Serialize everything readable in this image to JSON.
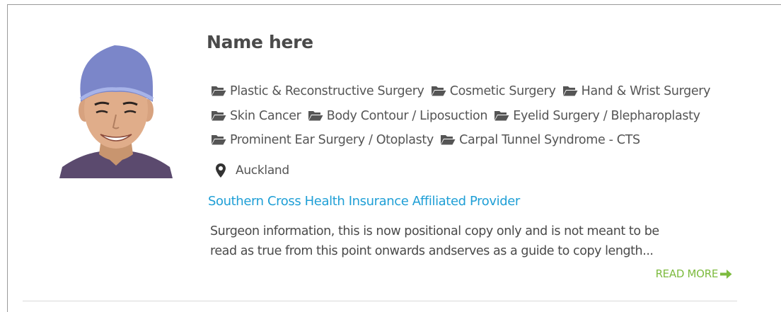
{
  "profile": {
    "name": "Name here",
    "categories": [
      "Plastic & Reconstructive Surgery",
      "Cosmetic Surgery",
      "Hand & Wrist Surgery",
      "Skin Cancer",
      "Body Contour / Liposuction",
      "Eyelid Surgery / Blepharoplasty",
      "Prominent Ear Surgery / Otoplasty",
      "Carpal Tunnel Syndrome - CTS"
    ],
    "location": "Auckland",
    "affiliation": "Southern Cross Health Insurance Affiliated Provider",
    "description_line1": "Surgeon information, this is now positional copy only and is not meant to be",
    "description_line2": "read as true from this point onwards andserves as a guide to copy length...",
    "read_more": "READ MORE"
  },
  "icons": {
    "category": "folder-open-icon",
    "location": "map-marker-icon",
    "read_more": "arrow-right-icon"
  },
  "colors": {
    "name": "#4a4a4a",
    "text": "#555555",
    "link": "#1f9fd6",
    "read_more": "#7dbb3f",
    "scrub_cap": "#7b86c9"
  }
}
